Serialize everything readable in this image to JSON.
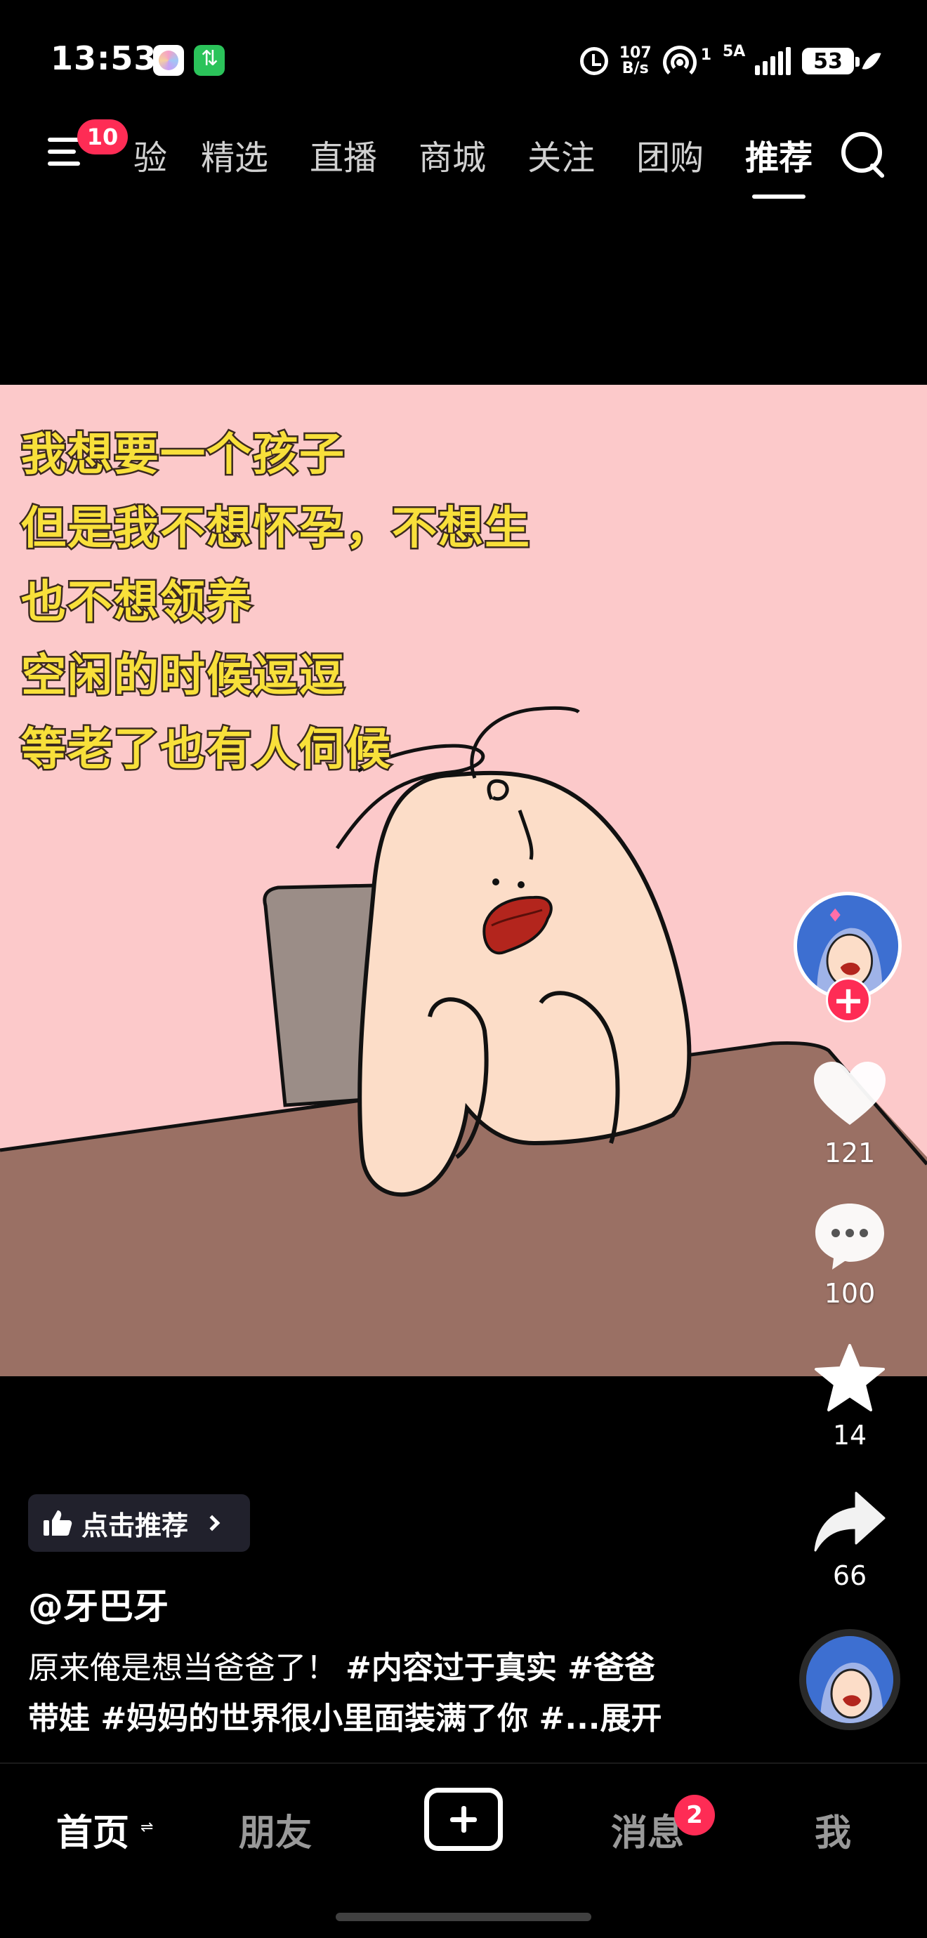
{
  "status_bar": {
    "time": "13:53",
    "net_speed_value": "107",
    "net_speed_unit": "B/s",
    "hotspot_sup": "1",
    "signal_label": "5A",
    "battery": "53",
    "icons": [
      "app-icon",
      "transfer-icon",
      "alarm-icon",
      "hotspot-icon",
      "signal-icon",
      "battery-icon",
      "leaf-icon"
    ]
  },
  "top_nav": {
    "menu_badge": "10",
    "tabs": [
      {
        "label": "经验",
        "visible_label": "验"
      },
      {
        "label": "精选"
      },
      {
        "label": "直播"
      },
      {
        "label": "商城"
      },
      {
        "label": "关注"
      },
      {
        "label": "团购"
      },
      {
        "label": "推荐",
        "active": true
      }
    ]
  },
  "video": {
    "caption_lines": [
      "我想要一个孩子",
      "但是我不想怀孕，不想生",
      "也不想领养",
      "空闲的时候逗逗",
      "等老了也有人伺候"
    ],
    "background_color": "#fcc9ca",
    "table_color": "#9a7064"
  },
  "actions": {
    "likes": "121",
    "comments": "100",
    "favorites": "14",
    "shares": "66",
    "follow_label": "+"
  },
  "info": {
    "recommend_label": "点击推荐",
    "author": "@牙巴牙",
    "description_text": "原来俺是想当爸爸了！",
    "tags_line1": "#内容过于真实 #爸爸",
    "tags_line2": "带娃 #妈妈的世界很小里面装满了你 #...",
    "expand_label": "展开"
  },
  "bottom_nav": {
    "home": "首页",
    "home_switch": "⇌",
    "friends": "朋友",
    "messages": "消息",
    "messages_badge": "2",
    "me": "我"
  },
  "colors": {
    "accent": "#fe2c55",
    "caption_yellow": "#f8e03a"
  }
}
